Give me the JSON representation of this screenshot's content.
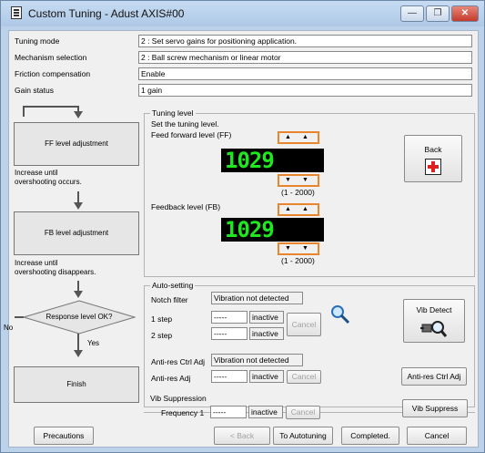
{
  "window": {
    "title": "Custom Tuning - Adust AXIS#00",
    "minimize": "—",
    "restore": "❐",
    "close": "✕"
  },
  "info": [
    {
      "label": "Tuning mode",
      "value": "2 : Set servo gains for positioning application."
    },
    {
      "label": "Mechanism selection",
      "value": "2 : Ball screw mechanism or linear motor"
    },
    {
      "label": "Friction compensation",
      "value": "Enable"
    },
    {
      "label": "Gain status",
      "value": "1 gain"
    }
  ],
  "flow": {
    "ff_box": "FF level adjustment",
    "ff_note": "Increase until\novershooting occurs.",
    "fb_box": "FB level adjustment",
    "fb_note": "Increase until\novershooting disappears.",
    "decision": "Response level OK?",
    "no_label": "No",
    "yes_label": "Yes",
    "finish": "Finish"
  },
  "tuning_level": {
    "group_title": "Tuning level",
    "instruction": "Set the tuning level.",
    "ff_label": "Feed forward level (FF)",
    "ff_value": "1029",
    "ff_range": "(1 - 2000)",
    "fb_label": "Feedback level (FB)",
    "fb_value": "1029",
    "fb_range": "(1 - 2000)",
    "up": "▲",
    "down": "▼",
    "back_label": "Back"
  },
  "auto_setting": {
    "group_title": "Auto-setting",
    "notch_label": "Notch filter",
    "notch_status": "Vibration not detected",
    "step1_label": "1 step",
    "step1_value": "-----",
    "step1_state": "inactive",
    "step2_label": "2 step",
    "step2_value": "-----",
    "step2_state": "inactive",
    "cancel": "Cancel",
    "vib_detect": "Vib Detect",
    "antires_ctrl_label": "Anti-res Ctrl Adj",
    "antires_ctrl_status": "Vibration not detected",
    "antires_adj_label": "Anti-res Adj",
    "antires_adj_value": "-----",
    "antires_adj_state": "inactive",
    "antires_cancel": "Cancel",
    "antires_button": "Anti-res Ctrl Adj"
  },
  "vib_suppression": {
    "title": "Vib Suppression",
    "freq_label": "Frequency 1",
    "freq_value": "-----",
    "freq_state": "inactive",
    "cancel": "Cancel",
    "button": "Vib Suppress"
  },
  "footer": {
    "precautions": "Precautions",
    "back": "< Back",
    "to_autotuning": "To Autotuning",
    "completed": "Completed.",
    "cancel": "Cancel"
  }
}
